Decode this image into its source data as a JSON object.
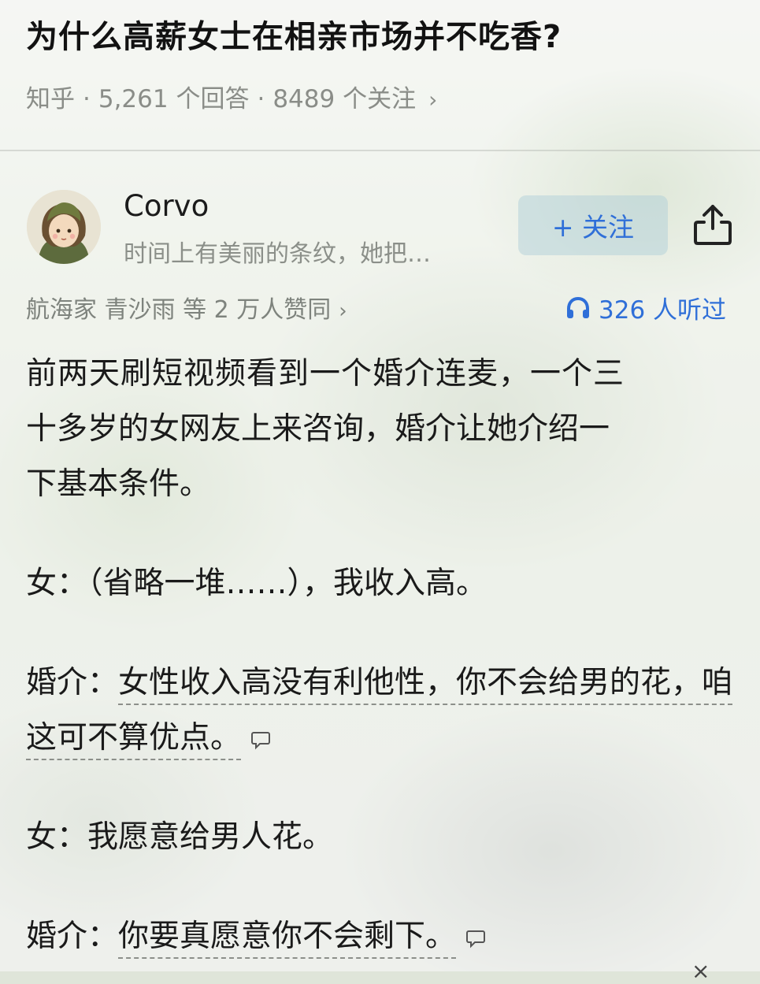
{
  "question": {
    "title": "为什么高薪女士在相亲市场并不吃香?",
    "source": "知乎",
    "answer_count": "5,261 个回答",
    "follow_count": "8489 个关注",
    "chevron": "›"
  },
  "author": {
    "name": "Corvo",
    "bio": "时间上有美丽的条纹，她把…",
    "follow_label": "+ 关注"
  },
  "stats": {
    "voters_text": "航海家 青沙雨 等 2 万人赞同",
    "listens_text": "326 人听过"
  },
  "answer": {
    "paragraphs": [
      "前两天刷短视频看到一个婚介连麦，一个三十多岁的女网友上来咨询，婚介让她介绍一下基本条件。",
      "女：（省略一堆……），我收入高。",
      "婚介：女性收入高没有利他性，你不会给男的花，咱这可不算优点。",
      "女：我愿意给男人花。",
      "婚介：你要真愿意你不会剩下。"
    ],
    "p1_line1": "前两天刷短视频看到一个婚介连麦，一个三",
    "p1_line2": "十多岁的女网友上来咨询，婚介让她介绍一",
    "p1_line3": "下基本条件。",
    "p2": "女：（省略一堆……），我收入高。",
    "p3_speaker": "婚介：",
    "p3_text": "女性收入高没有利他性，你不会给男的花，咱这可不算优点。",
    "p4": "女：我愿意给男人花。",
    "p5_speaker": "婚介：",
    "p5_text": "你要真愿意你不会剩下。"
  },
  "icons": {
    "share": "share-icon",
    "headphones": "headphones-icon",
    "comment": "comment-bubble-icon",
    "close": "close-icon"
  },
  "colors": {
    "accent": "#2f6fd8",
    "muted": "#8a8d88",
    "text": "#1a1a1a"
  }
}
